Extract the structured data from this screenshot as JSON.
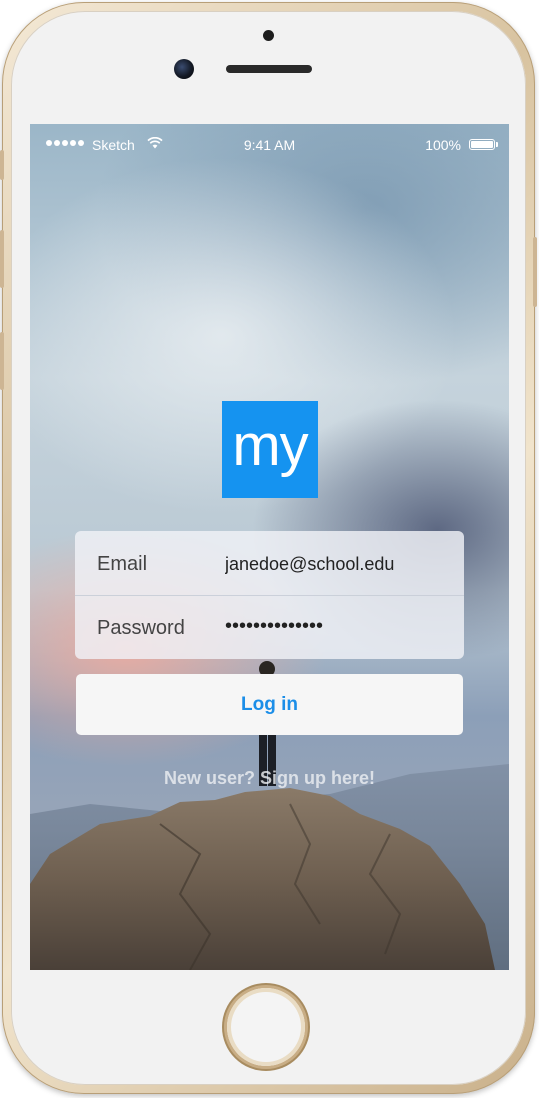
{
  "status_bar": {
    "carrier": "Sketch",
    "time": "9:41 AM",
    "battery_percent": "100%",
    "battery_level": 1.0,
    "signal_bars": 5
  },
  "logo": {
    "text": "my",
    "color": "#1593f0"
  },
  "login_form": {
    "email_label": "Email",
    "email_value": "janedoe@school.edu",
    "password_label": "Password",
    "password_value": "••••••••••••••"
  },
  "login_button": {
    "label": "Log in",
    "color": "#1b8ee8"
  },
  "signup_link": {
    "label": "New user? Sign up here!"
  }
}
